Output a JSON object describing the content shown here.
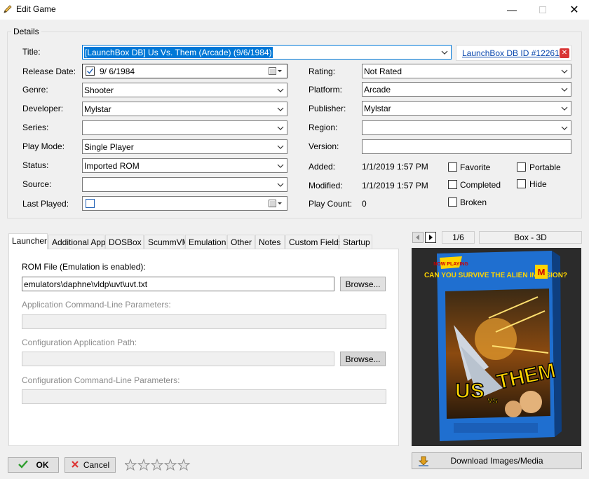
{
  "window": {
    "title": "Edit Game",
    "min_icon": "minimize-icon",
    "max_icon": "maximize-icon",
    "close_icon": "close-icon"
  },
  "details": {
    "group_label": "Details",
    "title_label": "Title:",
    "title_value": "[LaunchBox DB] Us Vs. Them (Arcade) (9/6/1984)",
    "db_link": "LaunchBox DB ID #12261",
    "release_label": "Release Date:",
    "release_value": "9/ 6/1984",
    "release_checked": true,
    "genre_label": "Genre:",
    "genre_value": "Shooter",
    "developer_label": "Developer:",
    "developer_value": "Mylstar",
    "series_label": "Series:",
    "series_value": "",
    "playmode_label": "Play Mode:",
    "playmode_value": "Single Player",
    "status_label": "Status:",
    "status_value": "Imported ROM",
    "source_label": "Source:",
    "source_value": "",
    "lastplayed_label": "Last Played:",
    "lastplayed_checked": false,
    "rating_label": "Rating:",
    "rating_value": "Not Rated",
    "platform_label": "Platform:",
    "platform_value": "Arcade",
    "publisher_label": "Publisher:",
    "publisher_value": "Mylstar",
    "region_label": "Region:",
    "region_value": "",
    "version_label": "Version:",
    "version_value": "",
    "added_label": "Added:",
    "added_value": "1/1/2019 1:57 PM",
    "modified_label": "Modified:",
    "modified_value": "1/1/2019 1:57 PM",
    "playcount_label": "Play Count:",
    "playcount_value": "0",
    "favorite_label": "Favorite",
    "completed_label": "Completed",
    "broken_label": "Broken",
    "portable_label": "Portable",
    "hide_label": "Hide"
  },
  "tabs": [
    "Launcher",
    "Additional Apps",
    "DOSBox",
    "ScummVM",
    "Emulation",
    "Other",
    "Notes",
    "Custom Fields",
    "Startup"
  ],
  "launcher": {
    "rom_label": "ROM File (Emulation is enabled):",
    "rom_value": "emulators\\daphne\\vldp\\uvt\\uvt.txt",
    "browse": "Browse...",
    "app_cmd_label": "Application Command-Line Parameters:",
    "config_path_label": "Configuration Application Path:",
    "config_cmd_label": "Configuration Command-Line Parameters:"
  },
  "media": {
    "page": "1/6",
    "type": "Box - 3D",
    "download_label": "Download Images/Media",
    "cover_top": "CAN YOU SURVIVE THE ALIEN INVASION?",
    "cover_badge": "NOW PLAYING",
    "cover_title_1": "US",
    "cover_title_vs": "VS",
    "cover_title_2": "THEM",
    "colors": {
      "box_blue": "#1f6fd0",
      "cover_yellow": "#ffd400"
    }
  },
  "footer": {
    "ok": "OK",
    "cancel": "Cancel",
    "rating_stars": 0,
    "stars_total": 5
  }
}
